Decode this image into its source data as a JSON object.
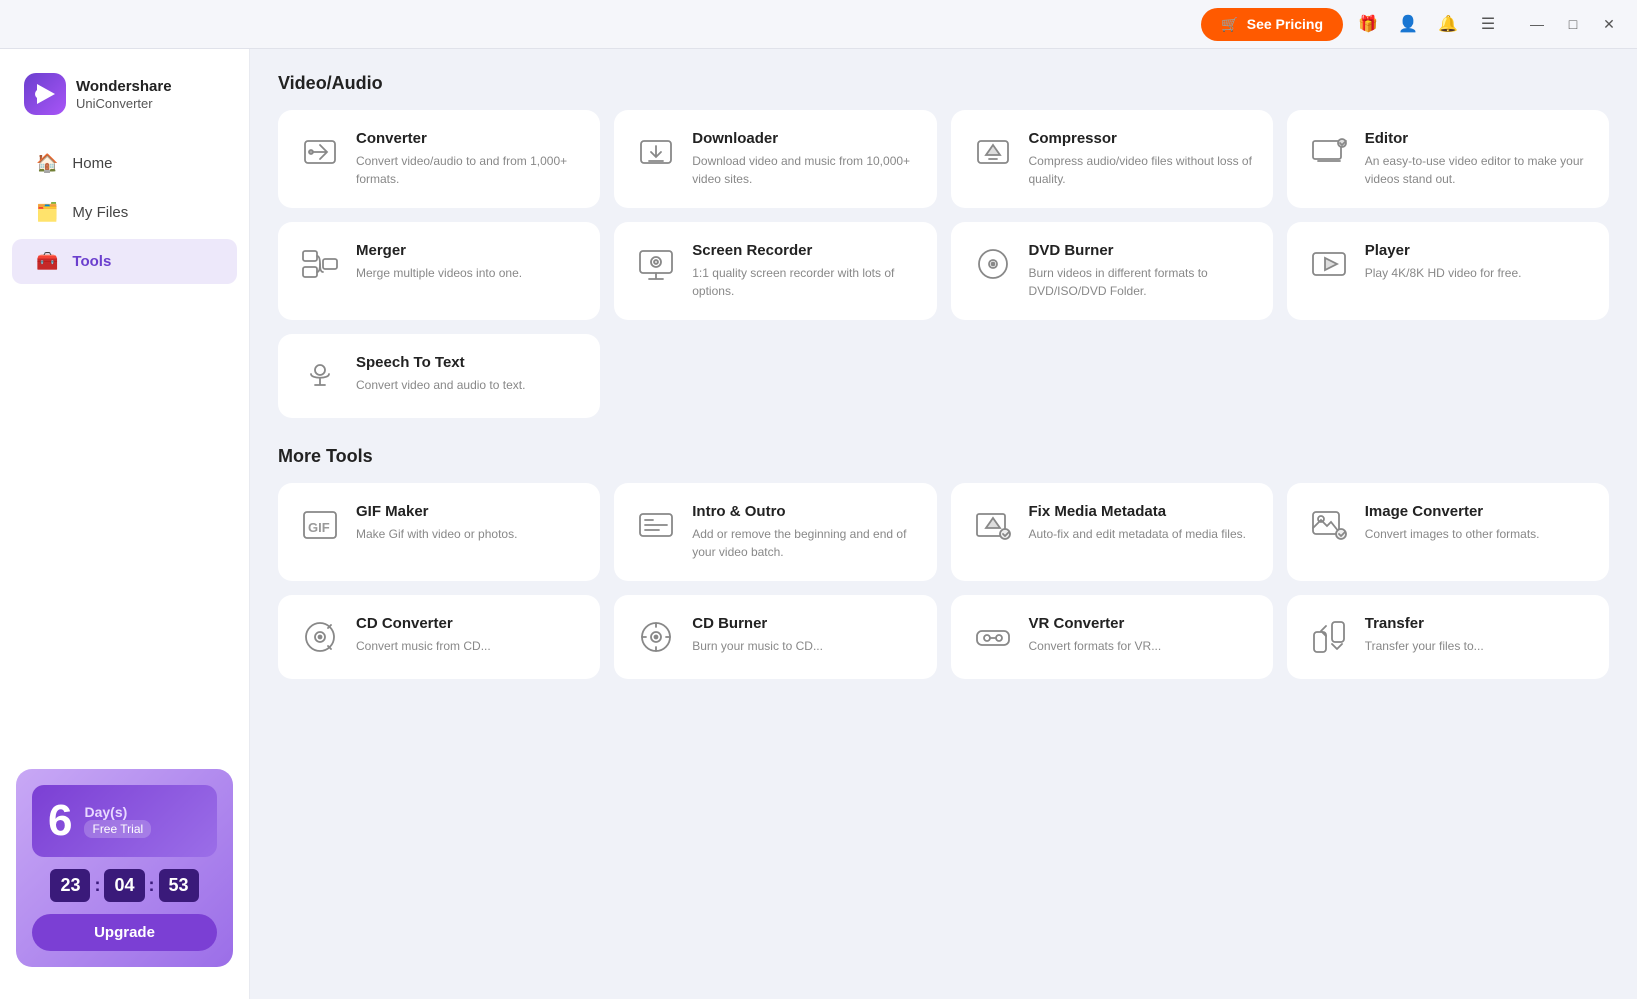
{
  "titlebar": {
    "see_pricing_label": "See Pricing",
    "cart_icon": "🛒",
    "gift_icon": "🎁",
    "user_icon": "👤",
    "notif_icon": "🔔",
    "menu_icon": "☰",
    "minimize_icon": "—",
    "maximize_icon": "□",
    "close_icon": "✕"
  },
  "logo": {
    "icon": "▶",
    "brand": "Wondershare",
    "product": "UniConverter"
  },
  "nav": {
    "home_label": "Home",
    "myfiles_label": "My Files",
    "tools_label": "Tools"
  },
  "trial": {
    "days_number": "6",
    "days_label": "Day(s)",
    "free_trial": "Free Trial",
    "timer_h": "23",
    "timer_m": "04",
    "timer_s": "53",
    "upgrade_label": "Upgrade"
  },
  "sections": {
    "video_audio": {
      "title": "Video/Audio",
      "tools": [
        {
          "name": "Converter",
          "desc": "Convert video/audio to and from 1,000+ formats.",
          "icon": "converter"
        },
        {
          "name": "Downloader",
          "desc": "Download video and music from 10,000+ video sites.",
          "icon": "downloader"
        },
        {
          "name": "Compressor",
          "desc": "Compress audio/video files without loss of quality.",
          "icon": "compressor"
        },
        {
          "name": "Editor",
          "desc": "An easy-to-use video editor to make your videos stand out.",
          "icon": "editor"
        },
        {
          "name": "Merger",
          "desc": "Merge multiple videos into one.",
          "icon": "merger"
        },
        {
          "name": "Screen Recorder",
          "desc": "1:1 quality screen recorder with lots of options.",
          "icon": "screen-recorder"
        },
        {
          "name": "DVD Burner",
          "desc": "Burn videos in different formats to DVD/ISO/DVD Folder.",
          "icon": "dvd-burner"
        },
        {
          "name": "Player",
          "desc": "Play 4K/8K HD video for free.",
          "icon": "player"
        },
        {
          "name": "Speech To Text",
          "desc": "Convert video and audio to text.",
          "icon": "speech-to-text"
        }
      ]
    },
    "more_tools": {
      "title": "More Tools",
      "tools": [
        {
          "name": "GIF Maker",
          "desc": "Make Gif with video or photos.",
          "icon": "gif-maker"
        },
        {
          "name": "Intro & Outro",
          "desc": "Add or remove the beginning and end of your video batch.",
          "icon": "intro-outro"
        },
        {
          "name": "Fix Media Metadata",
          "desc": "Auto-fix and edit metadata of media files.",
          "icon": "fix-metadata"
        },
        {
          "name": "Image Converter",
          "desc": "Convert images to other formats.",
          "icon": "image-converter"
        },
        {
          "name": "CD Converter",
          "desc": "Convert music from CD...",
          "icon": "cd-converter"
        },
        {
          "name": "CD Burner",
          "desc": "Burn your music to CD...",
          "icon": "cd-burner"
        },
        {
          "name": "VR Converter",
          "desc": "Convert formats for VR...",
          "icon": "vr-converter"
        },
        {
          "name": "Transfer",
          "desc": "Transfer your files to...",
          "icon": "transfer"
        }
      ]
    }
  }
}
